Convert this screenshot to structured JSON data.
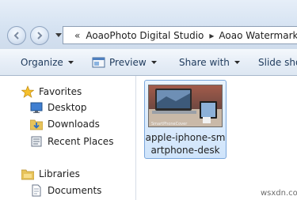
{
  "breadcrumb": {
    "overflow": "«",
    "separator": "▸",
    "items": [
      "AoaoPhoto Digital Studio",
      "Aoao Watermark"
    ]
  },
  "toolbar": {
    "organize": "Organize",
    "preview": "Preview",
    "share_with": "Share with",
    "slideshow": "Slide show"
  },
  "navpane": {
    "favorites": {
      "label": "Favorites",
      "items": [
        "Desktop",
        "Downloads",
        "Recent Places"
      ]
    },
    "libraries": {
      "label": "Libraries",
      "items": [
        "Documents"
      ]
    }
  },
  "files": [
    {
      "name_line1": "apple-iphone-sm",
      "name_line2": "artphone-desk",
      "thumbnail_caption": "SmartPhoneCover"
    }
  ],
  "watermark": "wsxdn.com"
}
